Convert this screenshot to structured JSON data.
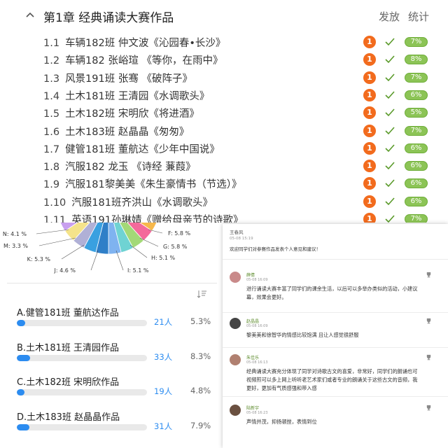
{
  "chapter": {
    "title": "第1章  经典诵读大赛作品",
    "publish_label": "发放",
    "stats_label": "统计"
  },
  "works": [
    {
      "no": "1.1",
      "text": "车辆182班 仲文波《沁园春•长沙》",
      "badge": "1",
      "percent": "7%"
    },
    {
      "no": "1.2",
      "text": "车辆182 张峪瑄 《等你，在雨中》",
      "badge": "1",
      "percent": "8%"
    },
    {
      "no": "1.3",
      "text": "风景191班 张骞 《破阵子》",
      "badge": "1",
      "percent": "7%"
    },
    {
      "no": "1.4",
      "text": "土木181班 王清园《水调歌头》",
      "badge": "1",
      "percent": "6%"
    },
    {
      "no": "1.5",
      "text": "土木182班 宋明欣《将进酒》",
      "badge": "1",
      "percent": "5%"
    },
    {
      "no": "1.6",
      "text": "土木183班 赵晶晶《匆匆》",
      "badge": "1",
      "percent": "7%"
    },
    {
      "no": "1.7",
      "text": "健管181班 董航达《少年中国说》",
      "badge": "1",
      "percent": "6%"
    },
    {
      "no": "1.8",
      "text": "汽服182 龙玉 《诗经 蒹葭》",
      "badge": "1",
      "percent": "6%"
    },
    {
      "no": "1.9",
      "text": "汽服181黎美美《朱生豪情书（节选）》",
      "badge": "1",
      "percent": "6%"
    },
    {
      "no": "1.10",
      "text": "汽服181班齐洪山《水调歌头》",
      "badge": "1",
      "percent": "6%"
    },
    {
      "no": "1.11",
      "text": "英语191孙琳婧《赠给母亲节的诗歌》",
      "badge": "1",
      "percent": "7%"
    }
  ],
  "pie_labels": [
    {
      "key": "N",
      "text": "N: 4.1 %"
    },
    {
      "key": "M",
      "text": "M: 3.3 %"
    },
    {
      "key": "K",
      "text": "K: 5.3 %"
    },
    {
      "key": "J",
      "text": "J: 4.6 %"
    },
    {
      "key": "I",
      "text": "I: 5.1 %"
    },
    {
      "key": "H",
      "text": "H: 5.1 %"
    },
    {
      "key": "G",
      "text": "G: 5.8 %"
    },
    {
      "key": "F",
      "text": "F: 5.8 %"
    }
  ],
  "pie_colors": [
    "#f7b84b",
    "#f46a9b",
    "#a3d977",
    "#6fd3d3",
    "#7fb3f0",
    "#2f7fc8",
    "#39a0e0",
    "#b0b0d6",
    "#f4e38a",
    "#c9a0ef"
  ],
  "poll_options": [
    {
      "label": "A.健管181班 董航达作品",
      "count": "21人",
      "percent": "5.3%",
      "share": 0.053
    },
    {
      "label": "B.土木181班 王清园作品",
      "count": "33人",
      "percent": "8.3%",
      "share": 0.083
    },
    {
      "label": "C.土木182班 宋明欣作品",
      "count": "19人",
      "percent": "4.8%",
      "share": 0.048
    },
    {
      "label": "D.土木183班 赵晶晶作品",
      "count": "31人",
      "percent": "7.9%",
      "share": 0.079
    }
  ],
  "post": {
    "author": "王春风",
    "date": "05-08 15:19",
    "text": "欢迎同学们对参赛作品发表个人意见和建议！"
  },
  "comments": [
    {
      "name": "薛倩",
      "date": "05-08 16:09",
      "lines": [
        "进行诵读大赛丰富了同学们的课余生活，以后可以多举办类似的活动，小建议",
        "幕，效果会更好。"
      ],
      "avatar": "#c98a8a"
    },
    {
      "name": "赵晶晶",
      "date": "05-08 16:09",
      "lines": [
        "黎美美和徐智华的情感比较饱满 且让人感觉很舒服"
      ],
      "avatar": "#444444"
    },
    {
      "name": "朱佳乐",
      "date": "05-08 16:13",
      "lines": [
        "经典诵读大赛充分体现了同学对诗歌古文的喜爱，非常好，同学们的朗诵也可",
        "视频煎可以多上网上听听老艺术家们或者专业的朗诵关于这些古文的音频，我",
        "更好，更加有气质感强和带入感"
      ],
      "avatar": "#b08070"
    },
    {
      "name": "陆新宇",
      "date": "05-08 16:23",
      "lines": [
        "声情并茂，抑扬顿挫，表情到位"
      ],
      "avatar": "#6a5040"
    }
  ]
}
